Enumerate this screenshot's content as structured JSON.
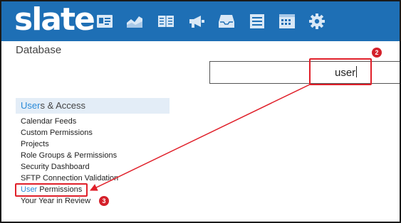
{
  "app": {
    "logo": "slate"
  },
  "nav": [
    {
      "name": "contact-card-icon"
    },
    {
      "name": "area-chart-icon"
    },
    {
      "name": "book-icon"
    },
    {
      "name": "megaphone-icon"
    },
    {
      "name": "inbox-tray-icon"
    },
    {
      "name": "list-icon"
    },
    {
      "name": "calendar-grid-icon"
    },
    {
      "name": "gear-icon"
    }
  ],
  "page": {
    "title": "Database"
  },
  "search": {
    "value": "user"
  },
  "section": {
    "highlight": "User",
    "rest": "s & Access"
  },
  "results": [
    {
      "label": "Calendar Feeds"
    },
    {
      "label": "Custom Permissions"
    },
    {
      "label": "Projects"
    },
    {
      "label": "Role Groups & Permissions"
    },
    {
      "label": "Security Dashboard"
    },
    {
      "label": "SFTP Connection Validation"
    },
    {
      "highlight": "User",
      "rest": " Permissions"
    },
    {
      "label": "Your Year in Review"
    }
  ],
  "annotations": {
    "badge_2": "2",
    "badge_3": "3"
  },
  "colors": {
    "brand": "#1e6fb5",
    "highlight": "#2a8ad8",
    "annotation": "#e0202a"
  }
}
